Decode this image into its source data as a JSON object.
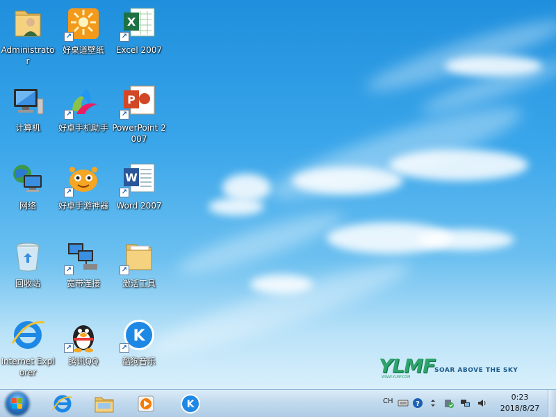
{
  "desktop": {
    "icons": [
      {
        "label": "Administrato r",
        "icon": "user-folder-icon"
      },
      {
        "label": "好桌道壁纸",
        "icon": "wallpaper-app-icon"
      },
      {
        "label": "Excel 2007",
        "icon": "excel-icon"
      },
      {
        "label": "计算机",
        "icon": "computer-icon"
      },
      {
        "label": "好卓手机助手",
        "icon": "phone-assistant-icon"
      },
      {
        "label": "PowerPoint 2007",
        "icon": "powerpoint-icon"
      },
      {
        "label": "网络",
        "icon": "network-icon"
      },
      {
        "label": "好卓手游神器",
        "icon": "game-tool-icon"
      },
      {
        "label": "Word 2007",
        "icon": "word-icon"
      },
      {
        "label": "回收站",
        "icon": "recycle-bin-icon"
      },
      {
        "label": "宽带连接",
        "icon": "broadband-icon"
      },
      {
        "label": "激活工具",
        "icon": "folder-icon"
      },
      {
        "label": "Internet Explorer",
        "icon": "internet-explorer-icon"
      },
      {
        "label": "腾讯QQ",
        "icon": "qq-penguin-icon"
      },
      {
        "label": "酷狗音乐",
        "icon": "kugou-icon"
      }
    ]
  },
  "wallpaper": {
    "logo": "YLMF",
    "slogan": "SOAR ABOVE THE SKY",
    "url": "WWW.YLMF.COM"
  },
  "taskbar": {
    "start_icon": "windows-orb-icon",
    "pinned": [
      {
        "name": "internet-explorer",
        "icon": "internet-explorer-icon"
      },
      {
        "name": "windows-explorer",
        "icon": "folder-icon"
      },
      {
        "name": "media-player",
        "icon": "media-player-icon"
      },
      {
        "name": "kugou",
        "icon": "kugou-icon"
      }
    ],
    "tray": {
      "language": "CH",
      "icons": [
        "keyboard-icon",
        "help-icon",
        "arrow-icon",
        "security-icon",
        "network-icon",
        "volume-icon"
      ]
    },
    "clock": {
      "time": "0:23",
      "date": "2018/8/27"
    }
  },
  "colors": {
    "sky_top": "#1f8fdd",
    "sky_bottom": "#eaf7fd",
    "logo_green": "#2ea36a",
    "taskbar": "#c8ddef"
  }
}
